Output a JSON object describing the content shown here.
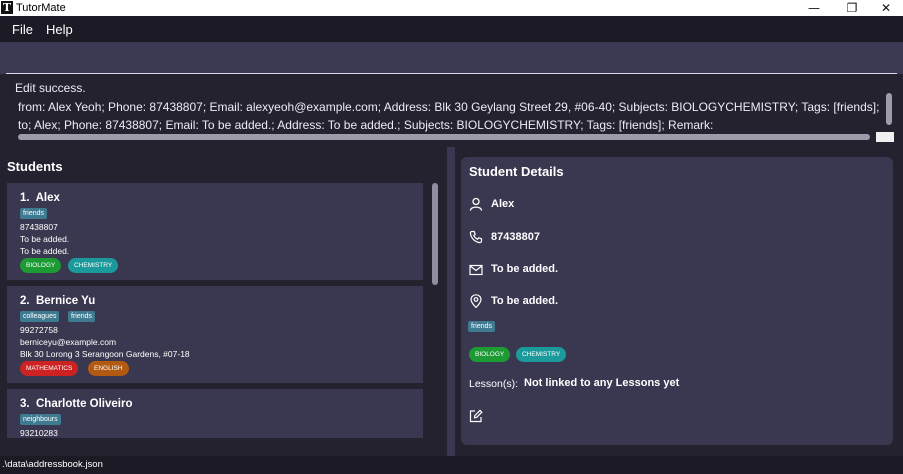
{
  "window": {
    "title": "TutorMate",
    "app_icon": "T",
    "minimize_glyph": "—",
    "maximize_glyph": "❐",
    "close_glyph": "✕"
  },
  "menu": {
    "items": [
      "File",
      "Help"
    ]
  },
  "command": {
    "value": ""
  },
  "result": {
    "line1": "Edit success.",
    "line2": "from: Alex Yeoh; Phone: 87438807; Email: alexyeoh@example.com; Address: Blk 30 Geylang Street 29, #06-40; Subjects: BIOLOGYCHEMISTRY; Tags: [friends]; Remark:",
    "line3": "to; Alex; Phone: 87438807; Email: To be added.; Address: To be added.; Subjects: BIOLOGYCHEMISTRY; Tags: [friends]; Remark:"
  },
  "students": {
    "title": "Students",
    "list": [
      {
        "index": "1.",
        "name": "Alex",
        "tags": [
          "friends"
        ],
        "lines": [
          "87438807",
          "To be added.",
          "To be added."
        ],
        "subjects": [
          {
            "label": "BIOLOGY",
            "color": "#1c9a33"
          },
          {
            "label": "CHEMISTRY",
            "color": "#1a9a9a"
          }
        ]
      },
      {
        "index": "2.",
        "name": "Bernice Yu",
        "tags": [
          "colleagues",
          "friends"
        ],
        "lines": [
          "99272758",
          "berniceyu@example.com",
          "Blk 30 Lorong 3 Serangoon Gardens, #07-18"
        ],
        "subjects": [
          {
            "label": "MATHEMATICS",
            "color": "#cc2222"
          },
          {
            "label": "ENGLISH",
            "color": "#b35a12"
          }
        ]
      },
      {
        "index": "3.",
        "name": "Charlotte Oliveiro",
        "tags": [
          "neighbours"
        ],
        "lines": [
          "93210283"
        ],
        "subjects": []
      }
    ]
  },
  "details": {
    "title": "Student Details",
    "name": "Alex",
    "phone": "87438807",
    "email": "To be added.",
    "address": "To be added.",
    "tags": [
      "friends"
    ],
    "subjects": [
      {
        "label": "BIOLOGY",
        "color": "#1c9a33"
      },
      {
        "label": "CHEMISTRY",
        "color": "#1a9a9a"
      }
    ],
    "lessons_label": "Lesson(s):",
    "lessons_value": "Not linked to any Lessons yet"
  },
  "status": {
    "path": ".\\data\\addressbook.json"
  }
}
